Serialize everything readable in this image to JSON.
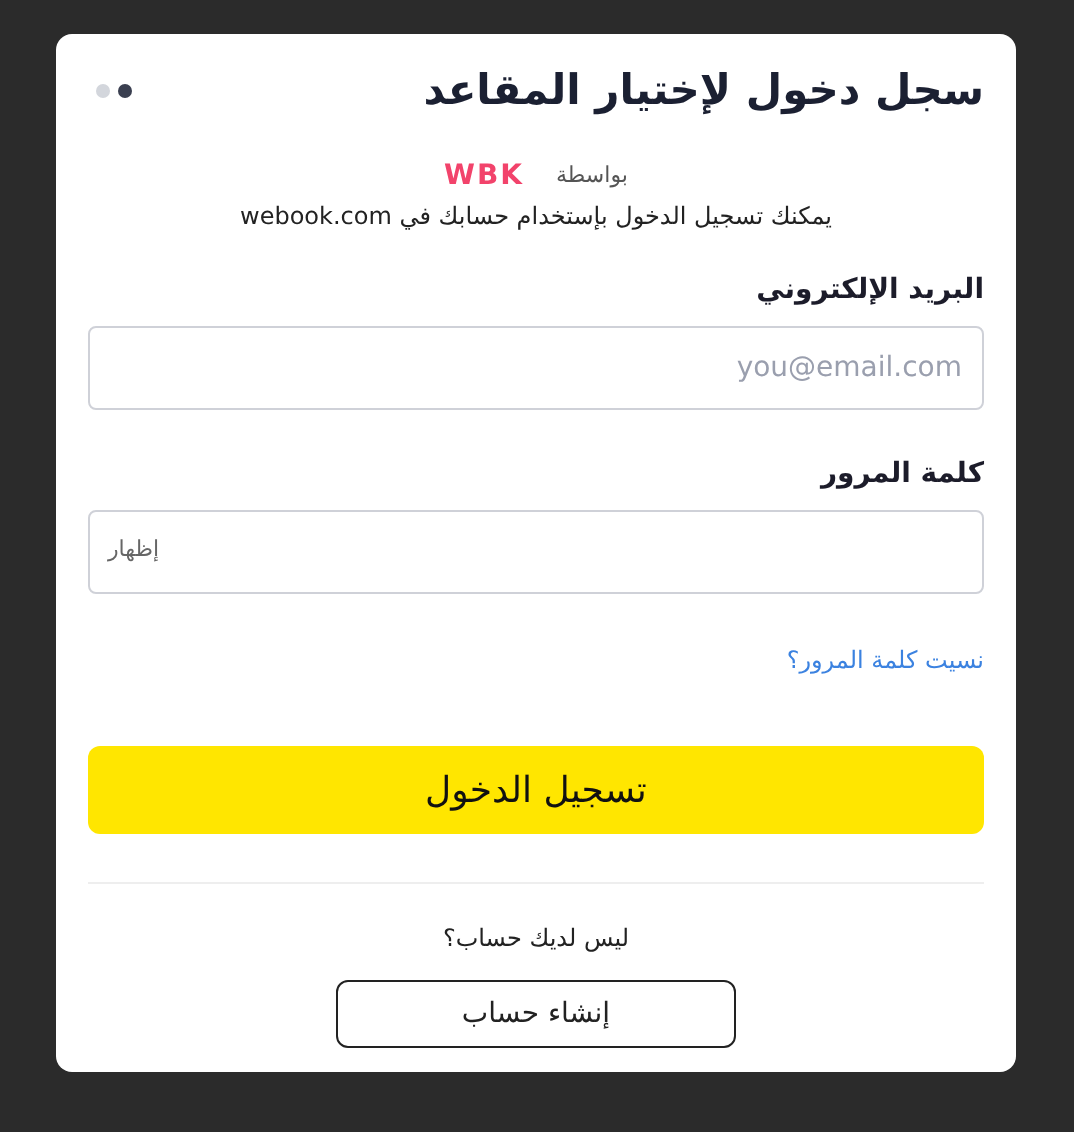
{
  "dialog": {
    "title": "سجل دخول لإختيار المقاعد",
    "steps": [
      {
        "selected": true
      },
      {
        "selected": false
      }
    ],
    "by_label": "بواسطة",
    "logo": "WBK",
    "subtitle": "يمكنك تسجيل الدخول بإستخدام حسابك في webook.com"
  },
  "fields": [
    {
      "label": "البريد الإلكتروني",
      "placeholder": "you@email.com"
    },
    {
      "label": "كلمة المرور",
      "toggle": "إظهار"
    }
  ],
  "forgot_link": "نسيت كلمة المرور؟",
  "login_button": "تسجيل الدخول",
  "signup_prompt": "ليس لديك حساب؟",
  "signup_button": "إنشاء حساب"
}
